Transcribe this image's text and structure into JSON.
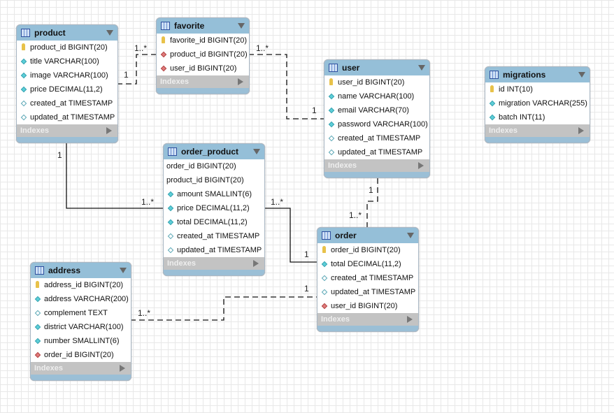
{
  "indexes_label": "Indexes",
  "tables": [
    {
      "id": "product",
      "name": "product",
      "columns": [
        {
          "text": "product_id BIGINT(20)",
          "icon": "pk"
        },
        {
          "text": "title VARCHAR(100)",
          "icon": "nn"
        },
        {
          "text": "image VARCHAR(100)",
          "icon": "nn"
        },
        {
          "text": "price DECIMAL(11,2)",
          "icon": "nn"
        },
        {
          "text": "created_at TIMESTAMP",
          "icon": "null"
        },
        {
          "text": "updated_at TIMESTAMP",
          "icon": "null"
        }
      ]
    },
    {
      "id": "favorite",
      "name": "favorite",
      "columns": [
        {
          "text": "favorite_id BIGINT(20)",
          "icon": "pk"
        },
        {
          "text": "product_id BIGINT(20)",
          "icon": "fk"
        },
        {
          "text": "user_id BIGINT(20)",
          "icon": "fk"
        }
      ]
    },
    {
      "id": "user",
      "name": "user",
      "columns": [
        {
          "text": "user_id BIGINT(20)",
          "icon": "pk"
        },
        {
          "text": "name VARCHAR(100)",
          "icon": "nn"
        },
        {
          "text": "email VARCHAR(70)",
          "icon": "nn"
        },
        {
          "text": "password VARCHAR(100)",
          "icon": "nn"
        },
        {
          "text": "created_at TIMESTAMP",
          "icon": "null"
        },
        {
          "text": "updated_at TIMESTAMP",
          "icon": "null"
        }
      ]
    },
    {
      "id": "migrations",
      "name": "migrations",
      "columns": [
        {
          "text": "id INT(10)",
          "icon": "pk"
        },
        {
          "text": "migration VARCHAR(255)",
          "icon": "nn"
        },
        {
          "text": "batch INT(11)",
          "icon": "nn"
        }
      ]
    },
    {
      "id": "order_product",
      "name": "order_product",
      "columns": [
        {
          "text": "order_id BIGINT(20)",
          "icon": "none"
        },
        {
          "text": "product_id BIGINT(20)",
          "icon": "none"
        },
        {
          "text": "amount SMALLINT(6)",
          "icon": "nn"
        },
        {
          "text": "price DECIMAL(11,2)",
          "icon": "nn"
        },
        {
          "text": "total DECIMAL(11,2)",
          "icon": "nn"
        },
        {
          "text": "created_at TIMESTAMP",
          "icon": "null"
        },
        {
          "text": "updated_at TIMESTAMP",
          "icon": "null"
        }
      ]
    },
    {
      "id": "order",
      "name": "order",
      "columns": [
        {
          "text": "order_id BIGINT(20)",
          "icon": "pk"
        },
        {
          "text": "total DECIMAL(11,2)",
          "icon": "nn"
        },
        {
          "text": "created_at TIMESTAMP",
          "icon": "null"
        },
        {
          "text": "updated_at TIMESTAMP",
          "icon": "null"
        },
        {
          "text": "user_id BIGINT(20)",
          "icon": "fk"
        }
      ]
    },
    {
      "id": "address",
      "name": "address",
      "columns": [
        {
          "text": "address_id BIGINT(20)",
          "icon": "pk"
        },
        {
          "text": "address VARCHAR(200)",
          "icon": "nn"
        },
        {
          "text": "complement TEXT",
          "icon": "null"
        },
        {
          "text": "district VARCHAR(100)",
          "icon": "nn"
        },
        {
          "text": "number SMALLINT(6)",
          "icon": "nn"
        },
        {
          "text": "order_id BIGINT(20)",
          "icon": "fk"
        }
      ]
    }
  ],
  "relations": [
    {
      "from": "product",
      "to": "favorite",
      "style": "dashed",
      "from_card": "1",
      "to_card": "1..*"
    },
    {
      "from": "user",
      "to": "favorite",
      "style": "dashed",
      "from_card": "1",
      "to_card": "1..*"
    },
    {
      "from": "product",
      "to": "order_product",
      "style": "solid",
      "from_card": "1",
      "to_card": "1..*"
    },
    {
      "from": "order",
      "to": "order_product",
      "style": "solid",
      "from_card": "1",
      "to_card": "1..*"
    },
    {
      "from": "user",
      "to": "order",
      "style": "dashed",
      "from_card": "1",
      "to_card": "1..*"
    },
    {
      "from": "order",
      "to": "address",
      "style": "dashed",
      "from_card": "1",
      "to_card": "1..*"
    }
  ]
}
